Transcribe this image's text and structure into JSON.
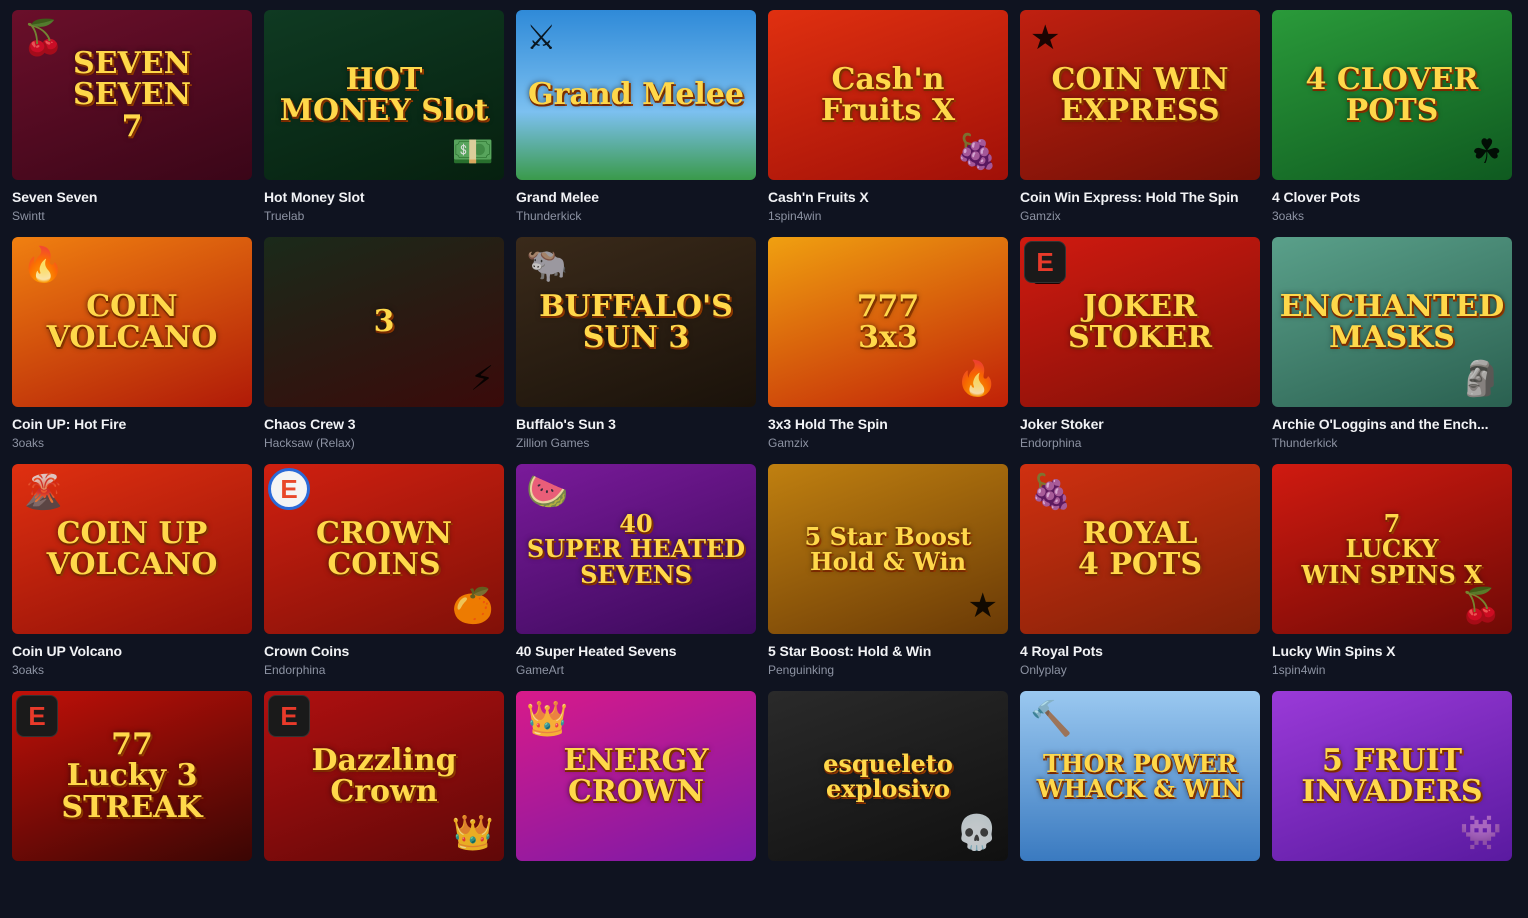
{
  "games": [
    {
      "title": "Seven Seven",
      "provider": "Swintt",
      "art": "SEVEN SEVEN\n7",
      "icon": "fruit-icon",
      "bg": "linear-gradient(160deg,#6a0f2a,#3a0618)",
      "deco": "🍒"
    },
    {
      "title": "Hot Money Slot",
      "provider": "Truelab",
      "art": "HOT\nMONEY Slot",
      "icon": "cash-icon",
      "bg": "linear-gradient(160deg,#0f3a22,#06200f)",
      "deco": "💵"
    },
    {
      "title": "Grand Melee",
      "provider": "Thunderkick",
      "art": "Grand Melee",
      "icon": "shield-icon",
      "bg": "linear-gradient(180deg,#2f8ad8,#7cc0f0 60%,#3a9a4a)",
      "deco": "⚔"
    },
    {
      "title": "Cash'n Fruits X",
      "provider": "1spin4win",
      "art": "Cash'n\nFruits X",
      "icon": "coin-icon",
      "bg": "linear-gradient(160deg,#e03010,#a01008)",
      "deco": "🍇"
    },
    {
      "title": "Coin Win Express: Hold The Spin",
      "provider": "Gamzix",
      "art": "COIN WIN\nEXPRESS",
      "icon": "coin-icon",
      "bg": "linear-gradient(160deg,#c02010,#701006)",
      "deco": "★"
    },
    {
      "title": "4 Clover Pots",
      "provider": "3oaks",
      "art": "4 CLOVER\nPOTS",
      "icon": "leprechaun-icon",
      "bg": "linear-gradient(160deg,#2a9a3a,#0f5a20)",
      "deco": "☘"
    },
    {
      "title": "Coin UP: Hot Fire",
      "provider": "3oaks",
      "art": "COIN\nVOLCANO",
      "icon": "volcano-icon",
      "bg": "linear-gradient(160deg,#f08010,#b01a08)",
      "deco": "🔥"
    },
    {
      "title": "Chaos Crew 3",
      "provider": "Hacksaw (Relax)",
      "art": "3",
      "icon": "chaos-icon",
      "bg": "linear-gradient(160deg,#1a2a1a,#3a0a0a)",
      "deco": "⚡"
    },
    {
      "title": "Buffalo's Sun 3",
      "provider": "Zillion Games",
      "art": "BUFFALO'S\nSUN 3",
      "icon": "buffalo-icon",
      "bg": "linear-gradient(160deg,#3a2a1a,#1a120a)",
      "deco": "🐃"
    },
    {
      "title": "3x3 Hold The Spin",
      "provider": "Gamzix",
      "art": "777\n3x3",
      "icon": "seven-icon",
      "bg": "linear-gradient(160deg,#f0a010,#c02008)",
      "deco": "🔥"
    },
    {
      "title": "Joker Stoker",
      "provider": "Endorphina",
      "art": "JOKER\nSTOKER",
      "icon": "joker-icon",
      "bg": "linear-gradient(160deg,#d01a10,#801008)",
      "deco": "🃏",
      "badge": "E"
    },
    {
      "title": "Archie O'Loggins and the Ench...",
      "provider": "Thunderkick",
      "art": "ENCHANTED\nMASKS",
      "icon": "mask-icon",
      "bg": "linear-gradient(160deg,#5aa08a,#2a6050)",
      "deco": "🗿"
    },
    {
      "title": "Coin UP Volcano",
      "provider": "3oaks",
      "art": "COIN UP\nVOLCANO",
      "icon": "volcano-icon",
      "bg": "linear-gradient(160deg,#e03010,#901008)",
      "deco": "🌋"
    },
    {
      "title": "Crown Coins",
      "provider": "Endorphina",
      "art": "CROWN COINS",
      "icon": "crown-icon",
      "bg": "linear-gradient(160deg,#d02010,#801008)",
      "deco": "🍊",
      "badge": "E",
      "badge_round": true
    },
    {
      "title": "40 Super Heated Sevens",
      "provider": "GameArt",
      "art": "40\nSUPER HEATED\nSEVENS",
      "icon": "watermelon-icon",
      "bg": "linear-gradient(160deg,#7a1a9a,#3a0a5a)",
      "deco": "🍉"
    },
    {
      "title": "5 Star Boost: Hold & Win",
      "provider": "Penguinking",
      "art": "5 Star Boost\nHold & Win",
      "icon": "star-icon",
      "bg": "linear-gradient(160deg,#c08010,#6a3a06)",
      "deco": "★"
    },
    {
      "title": "4 Royal Pots",
      "provider": "Onlyplay",
      "art": "ROYAL\n4 POTS",
      "icon": "grape-icon",
      "bg": "linear-gradient(160deg,#d03010,#802008)",
      "deco": "🍇"
    },
    {
      "title": "Lucky Win Spins X",
      "provider": "1spin4win",
      "art": "7\nLUCKY\nWIN SPINS X",
      "icon": "seven-icon",
      "bg": "linear-gradient(160deg,#d01a10,#700a06)",
      "deco": "🍒"
    },
    {
      "title": "",
      "provider": "",
      "art": "77\nLucky 3\nSTREAK",
      "icon": "seven-icon",
      "bg": "linear-gradient(160deg,#c01008,#3a0604)",
      "deco": "🔥",
      "badge": "E"
    },
    {
      "title": "",
      "provider": "",
      "art": "Dazzling\nCrown",
      "icon": "crown-icon",
      "bg": "linear-gradient(160deg,#b01010,#600808)",
      "deco": "👑",
      "badge": "E"
    },
    {
      "title": "",
      "provider": "",
      "art": "ENERGY CROWN",
      "icon": "crown-icon",
      "bg": "linear-gradient(160deg,#d81a8a,#7a1aa8)",
      "deco": "👑"
    },
    {
      "title": "",
      "provider": "",
      "art": "esqueleto\nexplosivo",
      "icon": "skull-icon",
      "bg": "linear-gradient(160deg,#2a2a2a,#101010)",
      "deco": "💀"
    },
    {
      "title": "",
      "provider": "",
      "art": "THOR POWER\nWHACK & WIN",
      "icon": "hammer-icon",
      "bg": "linear-gradient(180deg,#9ac8f0,#3a7ac0)",
      "deco": "🔨"
    },
    {
      "title": "",
      "provider": "",
      "art": "5 FRUIT\nINVADERS",
      "icon": "alien-icon",
      "bg": "linear-gradient(160deg,#9a3ad8,#5a1aa0)",
      "deco": "👾"
    }
  ]
}
